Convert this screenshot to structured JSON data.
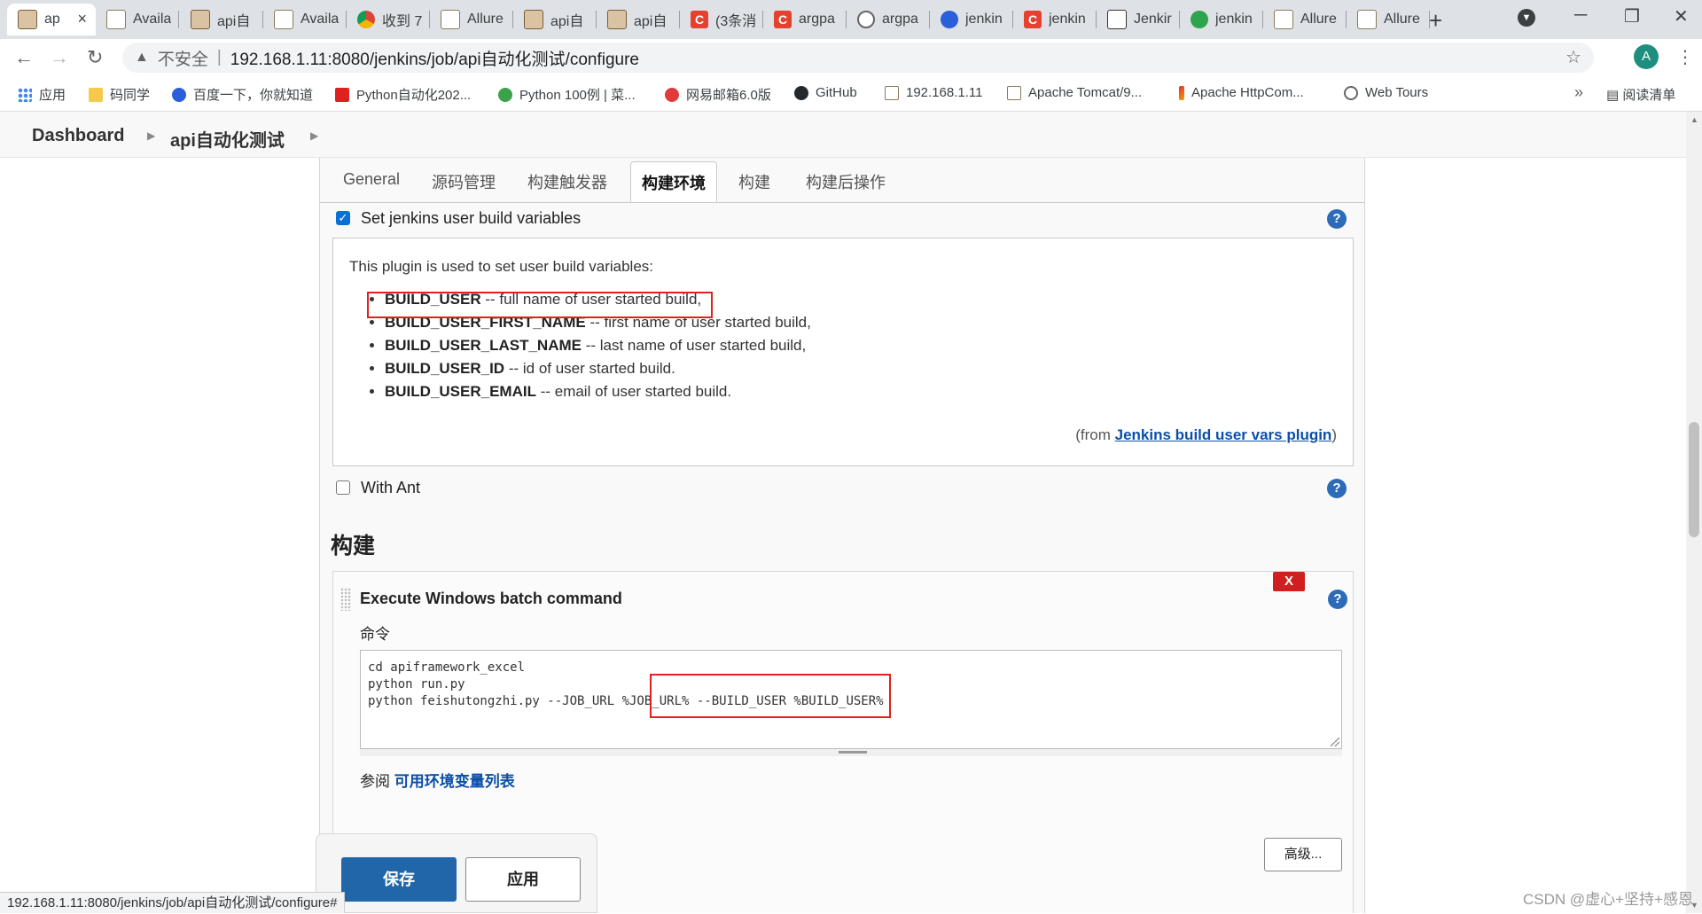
{
  "tabs": [
    {
      "label": "ap",
      "icon": "jenkins",
      "active": true
    },
    {
      "label": "Availa",
      "icon": "img"
    },
    {
      "label": "api自",
      "icon": "jenkins"
    },
    {
      "label": "Availa",
      "icon": "img"
    },
    {
      "label": "收到 7",
      "icon": "chrome"
    },
    {
      "label": "Allure",
      "icon": "img"
    },
    {
      "label": "api自",
      "icon": "jenkins"
    },
    {
      "label": "api自",
      "icon": "jenkins"
    },
    {
      "label": "(3条消",
      "icon": "c"
    },
    {
      "label": "argpa",
      "icon": "c"
    },
    {
      "label": "argpa",
      "icon": "globe"
    },
    {
      "label": "jenkin",
      "icon": "baidu"
    },
    {
      "label": "jenkin",
      "icon": "c"
    },
    {
      "label": "Jenkir",
      "icon": "git"
    },
    {
      "label": "jenkin",
      "icon": "green"
    },
    {
      "label": "Allure",
      "icon": "img"
    },
    {
      "label": "Allure",
      "icon": "img"
    }
  ],
  "toolbar": {
    "insecure_label": "不安全",
    "url": "192.168.1.11:8080/jenkins/job/api自动化测试/configure",
    "avatar_letter": "A"
  },
  "bookmarks": [
    {
      "label": "应用",
      "icon": "grid"
    },
    {
      "label": "码同学",
      "icon": "folder"
    },
    {
      "label": "百度一下，你就知道",
      "icon": "paw"
    },
    {
      "label": "Python自动化202...",
      "icon": "red"
    },
    {
      "label": "Python 100例 | 菜...",
      "icon": "greenc"
    },
    {
      "label": "网易邮箱6.0版",
      "icon": "pink"
    },
    {
      "label": "GitHub",
      "icon": "gh"
    },
    {
      "label": "192.168.1.11",
      "icon": "pic"
    },
    {
      "label": "Apache Tomcat/9...",
      "icon": "pic"
    },
    {
      "label": "Apache HttpCom...",
      "icon": "feather"
    },
    {
      "label": "Web Tours",
      "icon": "globe2"
    }
  ],
  "bookmarks_more": "»",
  "reading_list": "阅读清单",
  "breadcrumb": {
    "dashboard": "Dashboard",
    "job": "api自动化测试"
  },
  "config_tabs": [
    {
      "label": "General"
    },
    {
      "label": "源码管理"
    },
    {
      "label": "构建触发器"
    },
    {
      "label": "构建环境",
      "active": true
    },
    {
      "label": "构建"
    },
    {
      "label": "构建后操作"
    }
  ],
  "build_env": {
    "user_vars_label": "Set jenkins user build variables",
    "user_vars_checked": true,
    "plugin_intro": "This plugin is used to set user build variables:",
    "variables": [
      {
        "name": "BUILD_USER",
        "desc": " -- full name of user started build,"
      },
      {
        "name": "BUILD_USER_FIRST_NAME",
        "desc": " -- first name of user started build,"
      },
      {
        "name": "BUILD_USER_LAST_NAME",
        "desc": " -- last name of user started build,"
      },
      {
        "name": "BUILD_USER_ID",
        "desc": " -- id of user started build."
      },
      {
        "name": "BUILD_USER_EMAIL",
        "desc": " -- email of user started build."
      }
    ],
    "from_prefix": "(from ",
    "from_link": "Jenkins build user vars plugin",
    "from_suffix": ")",
    "with_ant_label": "With Ant",
    "with_ant_checked": false
  },
  "build": {
    "section_title": "构建",
    "step_title": "Execute Windows batch command",
    "delete_label": "X",
    "command_label": "命令",
    "command_text": "cd apiframework_excel\npython run.py\npython feishutongzhi.py --JOB_URL %JOB_URL% --BUILD_USER %BUILD_USER%",
    "see_also_prefix": "参阅 ",
    "see_also_link": "可用环境变量列表",
    "advanced_label": "高级..."
  },
  "actions": {
    "save": "保存",
    "apply": "应用"
  },
  "status_url": "192.168.1.11:8080/jenkins/job/api自动化测试/configure#",
  "watermark": "CSDN @虚心+坚持+感恩",
  "help_glyph": "?"
}
